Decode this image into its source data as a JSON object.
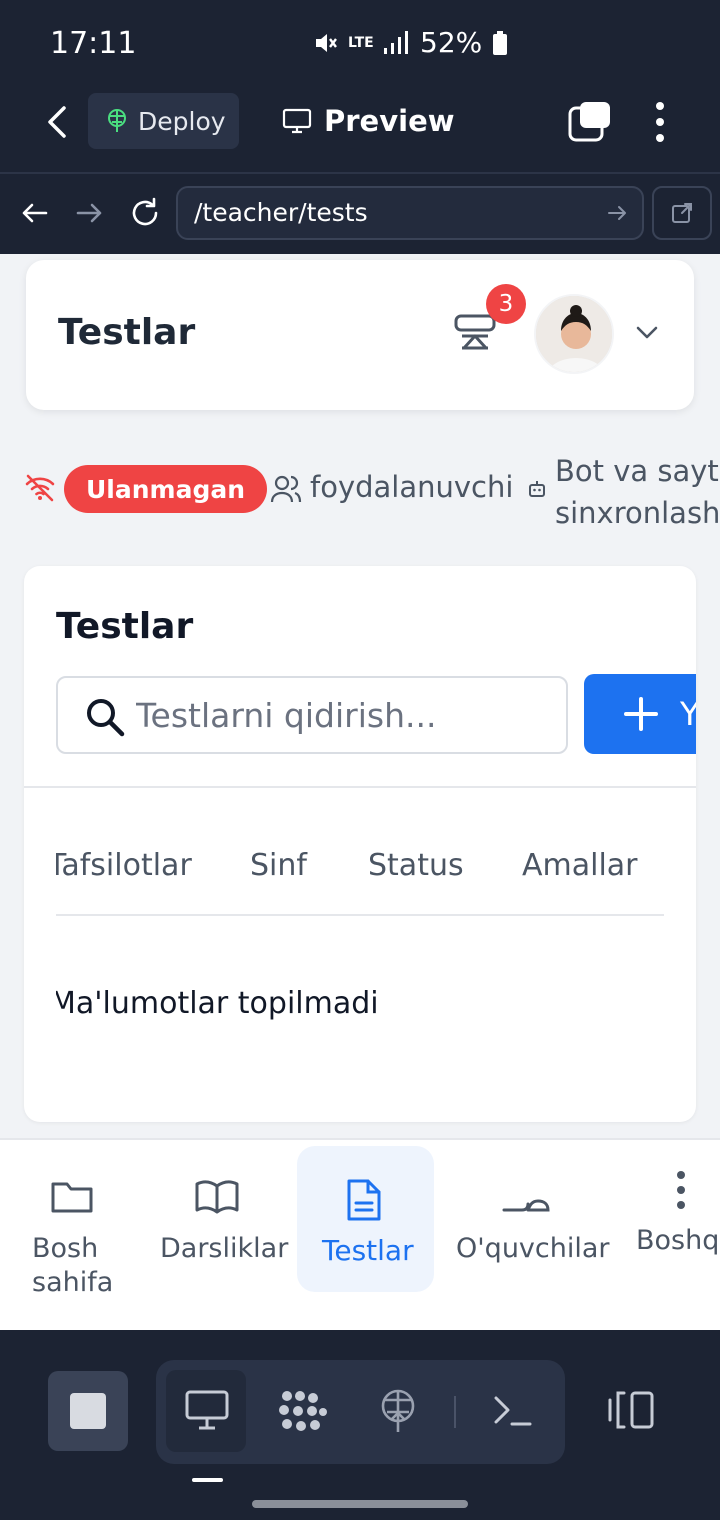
{
  "status_bar": {
    "time": "17:11",
    "network": "LTE",
    "battery": "52%"
  },
  "app_toolbar": {
    "deploy_label": "Deploy",
    "preview_label": "Preview"
  },
  "browser": {
    "url": "/teacher/tests"
  },
  "header": {
    "title": "Testlar",
    "notification_count": "3"
  },
  "connection": {
    "status_label": "Ulanmagan",
    "status_color": "#ef4444",
    "users_label": "foydalanuvchi",
    "sync_label": "Bot va sayt sinxronlash"
  },
  "tests": {
    "title": "Testlar",
    "search_placeholder": "Testlarni qidirish...",
    "add_label": "Ya",
    "columns": [
      "Tafsilotlar",
      "Sinf",
      "Status",
      "Amallar"
    ],
    "empty_message": "Ma'lumotlar topilmadi"
  },
  "bottom_nav": {
    "items": [
      {
        "label": "Bosh sahifa",
        "icon": "folder-icon"
      },
      {
        "label": "Darsliklar",
        "icon": "book-icon"
      },
      {
        "label": "Testlar",
        "icon": "document-icon",
        "active": true
      },
      {
        "label": "O'quvchilar",
        "icon": "students-icon"
      },
      {
        "label": "Boshqa",
        "icon": "more-vertical-icon"
      }
    ]
  },
  "colors": {
    "accent": "#1d72f0",
    "chrome": "#1c2333",
    "danger": "#ef4444"
  }
}
